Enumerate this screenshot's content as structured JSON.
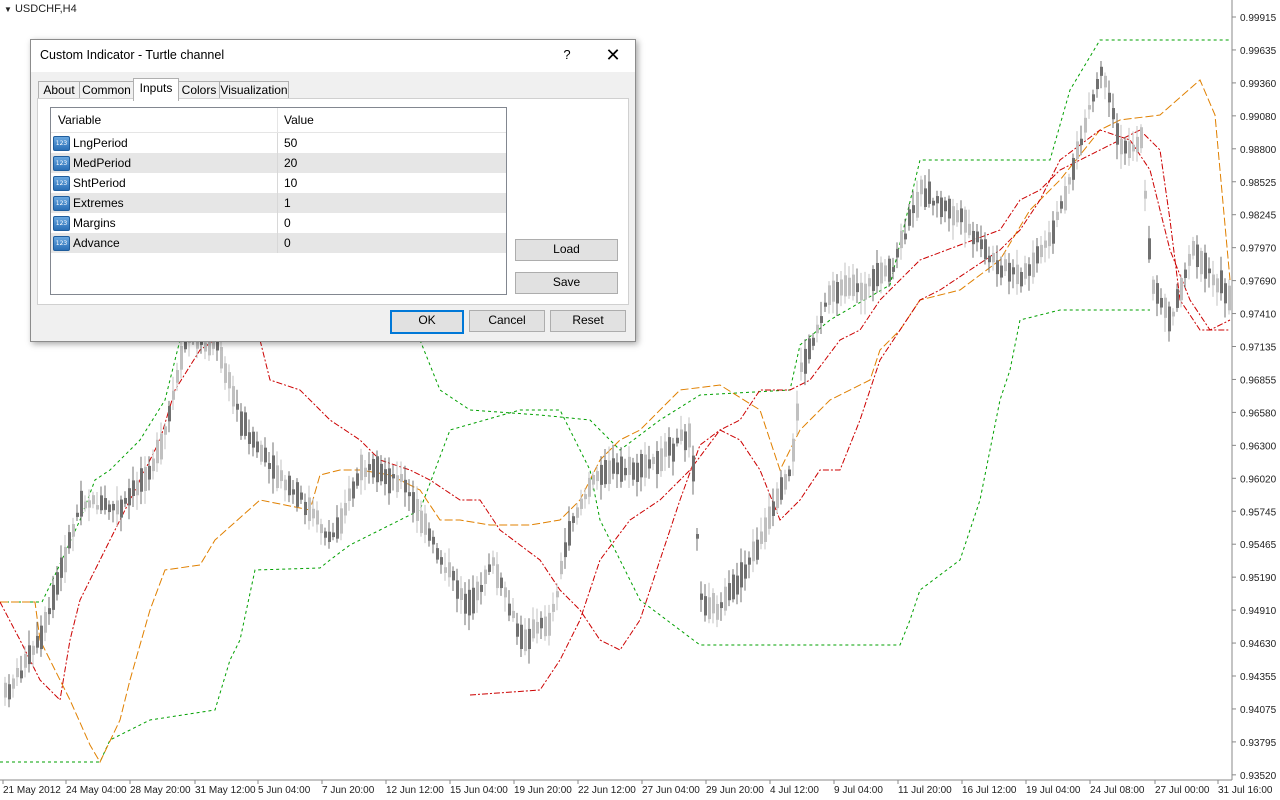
{
  "chart": {
    "symbol": "USDCHF,H4",
    "price_labels": [
      "0.99915",
      "0.99635",
      "0.99360",
      "0.99080",
      "0.98800",
      "0.98525",
      "0.98245",
      "0.97970",
      "0.97690",
      "0.97410",
      "0.97135",
      "0.96855",
      "0.96580",
      "0.96300",
      "0.96020",
      "0.95745",
      "0.95465",
      "0.95190",
      "0.94910",
      "0.94630",
      "0.94355",
      "0.94075",
      "0.93795",
      "0.93520"
    ],
    "time_labels": [
      "21 May 2012",
      "24 May 04:00",
      "28 May 20:00",
      "31 May 12:00",
      "5 Jun 04:00",
      "7 Jun 20:00",
      "12 Jun 12:00",
      "15 Jun 04:00",
      "19 Jun 20:00",
      "22 Jun 12:00",
      "27 Jun 04:00",
      "29 Jun 20:00",
      "4 Jul 12:00",
      "9 Jul 04:00",
      "11 Jul 20:00",
      "16 Jul 12:00",
      "19 Jul 04:00",
      "24 Jul 08:00",
      "27 Jul 00:00",
      "31 Jul 16:00"
    ],
    "colors": {
      "long_channel": "#00a000",
      "medium_channel": "#e08000",
      "short_channel": "#cc0000",
      "bull_candle": "#c0c0c0",
      "bear_candle": "#707070"
    }
  },
  "dialog": {
    "title": "Custom Indicator - Turtle channel",
    "help_label": "?",
    "close_label": "✕",
    "tabs": [
      "About",
      "Common",
      "Inputs",
      "Colors",
      "Visualization"
    ],
    "active_tab": "Inputs",
    "grid": {
      "col_variable": "Variable",
      "col_value": "Value",
      "icon_text": "123",
      "rows": [
        {
          "name": "LngPeriod",
          "value": "50"
        },
        {
          "name": "MedPeriod",
          "value": "20"
        },
        {
          "name": "ShtPeriod",
          "value": "10"
        },
        {
          "name": "Extremes",
          "value": "1"
        },
        {
          "name": "Margins",
          "value": "0"
        },
        {
          "name": "Advance",
          "value": "0"
        }
      ]
    },
    "buttons": {
      "load": "Load",
      "save": "Save",
      "ok": "OK",
      "cancel": "Cancel",
      "reset": "Reset"
    }
  }
}
